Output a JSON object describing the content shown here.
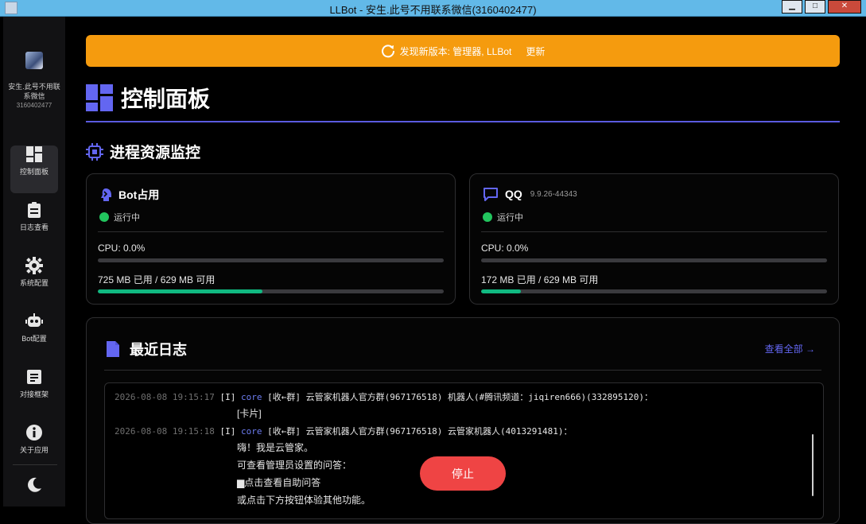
{
  "window": {
    "title": "LLBot - 安生.此号不用联系微信(3160402477)"
  },
  "sidebar": {
    "profile": {
      "name": "安生.此号不用联系微信",
      "id": "3160402477"
    },
    "items": [
      {
        "label": "控制面板",
        "icon": "dashboard-icon"
      },
      {
        "label": "日志查看",
        "icon": "clipboard-icon"
      },
      {
        "label": "系统配置",
        "icon": "gear-icon"
      },
      {
        "label": "Bot配置",
        "icon": "robot-icon"
      },
      {
        "label": "对接框架",
        "icon": "document-list-icon"
      },
      {
        "label": "关于应用",
        "icon": "info-icon"
      }
    ],
    "theme_icon": "moon-icon"
  },
  "banner": {
    "text": "发现新版本: 管理器, LLBot",
    "action": "更新"
  },
  "page_title": "控制面板",
  "section_title": "进程资源监控",
  "cards": {
    "bot": {
      "name": "Bot占用",
      "status": "运行中",
      "cpu": "CPU: 0.0%",
      "cpu_percent": 0,
      "memory": "725 MB 已用 / 629 MB 可用",
      "memory_percent": 47.5
    },
    "qq": {
      "name": "QQ",
      "version": "9.9.26-44343",
      "status": "运行中",
      "cpu": "CPU: 0.0%",
      "cpu_percent": 0,
      "memory": "172 MB 已用 / 629 MB 可用",
      "memory_percent": 11.5
    }
  },
  "logs": {
    "title": "最近日志",
    "view_all": "查看全部 →",
    "entries": [
      {
        "timestamp": "2026-08-08 19:15:17",
        "level": "[I]",
        "module": "core",
        "message": "[收←群] 云管家机器人官方群(967176518) 机器人(#腾讯频道：jiqiren666)(332895120)：",
        "lines": [
          "[卡片]"
        ]
      },
      {
        "timestamp": "2026-08-08 19:15:18",
        "level": "[I]",
        "module": "core",
        "message": "[收←群] 云管家机器人官方群(967176518) 云管家机器人(4013291481)：",
        "lines": [
          "嗨！我是云管家。",
          "可查看管理员设置的问答：",
          "▆点击查看自助问答",
          "或点击下方按钮体验其他功能。"
        ]
      }
    ]
  },
  "stop_button": "停止"
}
